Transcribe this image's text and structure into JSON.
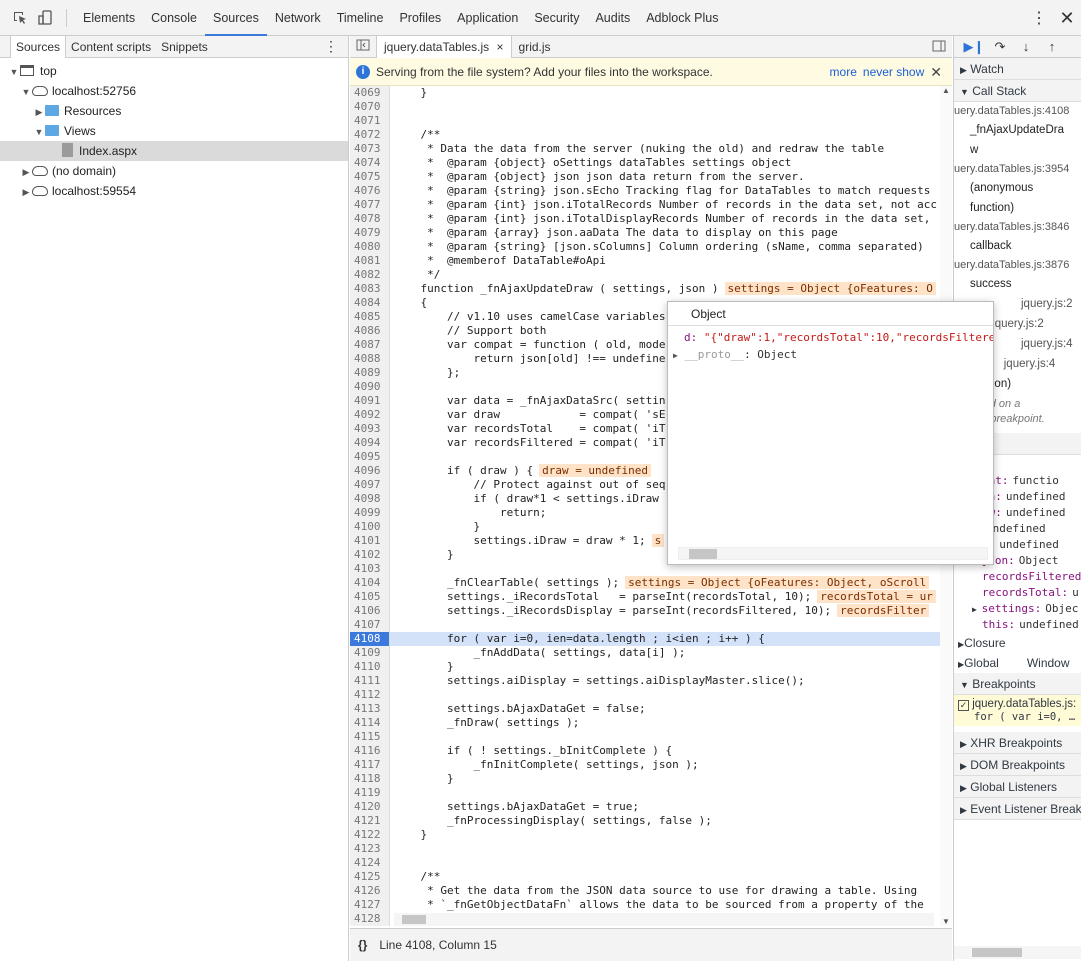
{
  "toolbar": {
    "tabs": [
      "Elements",
      "Console",
      "Sources",
      "Network",
      "Timeline",
      "Profiles",
      "Application",
      "Security",
      "Audits",
      "Adblock Plus"
    ],
    "active_tab": "Sources"
  },
  "navigator": {
    "tabs": [
      "Sources",
      "Content scripts",
      "Snippets"
    ],
    "tree": {
      "top": "top",
      "host1": "localhost:52756",
      "resources": "Resources",
      "views": "Views",
      "file": "Index.aspx",
      "nodomain": "(no domain)",
      "host2": "localhost:59554"
    }
  },
  "editor": {
    "tabs": [
      "jquery.dataTables.js",
      "grid.js"
    ],
    "info": "Serving from the file system? Add your files into the workspace.",
    "info_more": "more",
    "info_never": "never show",
    "status": "Line 4108, Column 15",
    "status_icon": "{}"
  },
  "code_lines": [
    {
      "n": "4069",
      "t": "    }"
    },
    {
      "n": "4070",
      "t": ""
    },
    {
      "n": "4071",
      "t": ""
    },
    {
      "n": "4072",
      "t": "    /**",
      "c": "cm"
    },
    {
      "n": "4073",
      "t": "     * Data the data from the server (nuking the old) and redraw the table",
      "c": "cm"
    },
    {
      "n": "4074",
      "t": "     *  @param {object} oSettings dataTables settings object",
      "c": "cm"
    },
    {
      "n": "4075",
      "t": "     *  @param {object} json json data return from the server.",
      "c": "cm"
    },
    {
      "n": "4076",
      "t": "     *  @param {string} json.sEcho Tracking flag for DataTables to match requests",
      "c": "cm"
    },
    {
      "n": "4077",
      "t": "     *  @param {int} json.iTotalRecords Number of records in the data set, not acc",
      "c": "cm"
    },
    {
      "n": "4078",
      "t": "     *  @param {int} json.iTotalDisplayRecords Number of records in the data set, ",
      "c": "cm"
    },
    {
      "n": "4079",
      "t": "     *  @param {array} json.aaData The data to display on this page",
      "c": "cm"
    },
    {
      "n": "4080",
      "t": "     *  @param {string} [json.sColumns] Column ordering (sName, comma separated)",
      "c": "cm"
    },
    {
      "n": "4081",
      "t": "     *  @memberof DataTable#oApi",
      "c": "cm"
    },
    {
      "n": "4082",
      "t": "     */",
      "c": "cm"
    },
    {
      "n": "4083",
      "t": "    function _fnAjaxUpdateDraw ( settings, json )",
      "i": "settings = Object {oFeatures: O"
    },
    {
      "n": "4084",
      "t": "    {"
    },
    {
      "n": "4085",
      "t": "        // v1.10 uses camelCase variables",
      "c": "cm"
    },
    {
      "n": "4086",
      "t": "        // Support both",
      "c": "cm"
    },
    {
      "n": "4087",
      "t": "        var compat = function ( old, mode"
    },
    {
      "n": "4088",
      "t": "            return json[old] !== undefine"
    },
    {
      "n": "4089",
      "t": "        };"
    },
    {
      "n": "4090",
      "t": ""
    },
    {
      "n": "4091",
      "t": "        var data = _fnAjaxDataSrc( settin"
    },
    {
      "n": "4092",
      "t": "        var draw            = compat( 'sE"
    },
    {
      "n": "4093",
      "t": "        var recordsTotal    = compat( 'iT"
    },
    {
      "n": "4094",
      "t": "        var recordsFiltered = compat( 'iT"
    },
    {
      "n": "4095",
      "t": ""
    },
    {
      "n": "4096",
      "t": "        if ( draw ) {",
      "i": "draw = undefined"
    },
    {
      "n": "4097",
      "t": "            // Protect against out of seq",
      "c": "cm"
    },
    {
      "n": "4098",
      "t": "            if ( draw*1 < settings.iDraw"
    },
    {
      "n": "4099",
      "t": "                return;"
    },
    {
      "n": "4100",
      "t": "            }"
    },
    {
      "n": "4101",
      "t": "            settings.iDraw = draw * 1;",
      "i": "s"
    },
    {
      "n": "4102",
      "t": "        }"
    },
    {
      "n": "4103",
      "t": ""
    },
    {
      "n": "4104",
      "t": "        _fnClearTable( settings );",
      "i": "settings = Object {oFeatures: Object, oScroll"
    },
    {
      "n": "4105",
      "t": "        settings._iRecordsTotal   = parseInt(recordsTotal, 10);",
      "i": "recordsTotal = ur"
    },
    {
      "n": "4106",
      "t": "        settings._iRecordsDisplay = parseInt(recordsFiltered, 10);",
      "i": "recordsFilter"
    },
    {
      "n": "4107",
      "t": ""
    },
    {
      "n": "4108",
      "t": "        for ( var i=0, ien=data.length ; i<ien ; i++ ) {",
      "exec": true
    },
    {
      "n": "4109",
      "t": "            _fnAddData( settings, data[i] );"
    },
    {
      "n": "4110",
      "t": "        }"
    },
    {
      "n": "4111",
      "t": "        settings.aiDisplay = settings.aiDisplayMaster.slice();"
    },
    {
      "n": "4112",
      "t": ""
    },
    {
      "n": "4113",
      "t": "        settings.bAjaxDataGet = false;"
    },
    {
      "n": "4114",
      "t": "        _fnDraw( settings );"
    },
    {
      "n": "4115",
      "t": ""
    },
    {
      "n": "4116",
      "t": "        if ( ! settings._bInitComplete ) {"
    },
    {
      "n": "4117",
      "t": "            _fnInitComplete( settings, json );"
    },
    {
      "n": "4118",
      "t": "        }"
    },
    {
      "n": "4119",
      "t": ""
    },
    {
      "n": "4120",
      "t": "        settings.bAjaxDataGet = true;"
    },
    {
      "n": "4121",
      "t": "        _fnProcessingDisplay( settings, false );"
    },
    {
      "n": "4122",
      "t": "    }"
    },
    {
      "n": "4123",
      "t": ""
    },
    {
      "n": "4124",
      "t": ""
    },
    {
      "n": "4125",
      "t": "    /**",
      "c": "cm"
    },
    {
      "n": "4126",
      "t": "     * Get the data from the JSON data source to use for drawing a table. Using",
      "c": "cm"
    },
    {
      "n": "4127",
      "t": "     * `_fnGetObjectDataFn` allows the data to be sourced from a property of the",
      "c": "cm"
    },
    {
      "n": "4128",
      "t": ""
    }
  ],
  "popover": {
    "title": "Object",
    "row1_key": "d:",
    "row1_val": "\"{\"draw\":1,\"recordsTotal\":10,\"recordsFiltere",
    "row2_key": "__proto__",
    "row2_val": ": Object"
  },
  "right": {
    "watch": "Watch",
    "callstack": "Call Stack",
    "frames": [
      {
        "loc": "uery.dataTables.js:4108",
        "fn": "_fnAjaxUpdateDra",
        "fn2": "w"
      },
      {
        "loc": "uery.dataTables.js:3954",
        "fn": "(anonymous",
        "fn2": "function)"
      },
      {
        "loc": "uery.dataTables.js:3846",
        "fn": "callback",
        "fn2": ""
      },
      {
        "loc": "uery.dataTables.js:3876",
        "fn": "success",
        "fn2": ""
      }
    ],
    "jq_frames": [
      "jquery.js:2",
      "jquery.js:2",
      "jquery.js:4",
      "jquery.js:4"
    ],
    "ith": "ith",
    "y": "y",
    "s_function": "s function)",
    "paused1": "used on a",
    "paused2": "ript breakpoint.",
    "scope_label": "e",
    "scope": [
      {
        "k": "1",
        "v": ""
      },
      {
        "k": "pat:",
        "v": "functio"
      },
      {
        "k": "ta:",
        "v": "undefined"
      },
      {
        "k": "aw:",
        "v": "undefined"
      },
      {
        "k": "",
        "v": "undefined"
      },
      {
        "k": "n:",
        "v": "undefined"
      },
      {
        "k": "json:",
        "v": "Object",
        "tri": true
      },
      {
        "k": "recordsFiltered",
        "v": ""
      },
      {
        "k": "recordsTotal:",
        "v": "u"
      },
      {
        "k": "settings:",
        "v": "Objec",
        "tri": true
      },
      {
        "k": "this:",
        "v": "undefined"
      }
    ],
    "closure": "Closure",
    "global": "Global",
    "global_val": "Window",
    "breakpoints": "Breakpoints",
    "bp_file": "jquery.dataTables.js:",
    "bp_code": "for ( var i=0, …",
    "xhr": "XHR Breakpoints",
    "dom": "DOM Breakpoints",
    "gl": "Global Listeners",
    "el": "Event Listener Breakpo"
  },
  "colors": {
    "accent": "#3b79dc",
    "exec_line": "#d3e2f9",
    "inline_value_bg": "#ffe3c8",
    "infobar_bg": "#fffbe3"
  }
}
